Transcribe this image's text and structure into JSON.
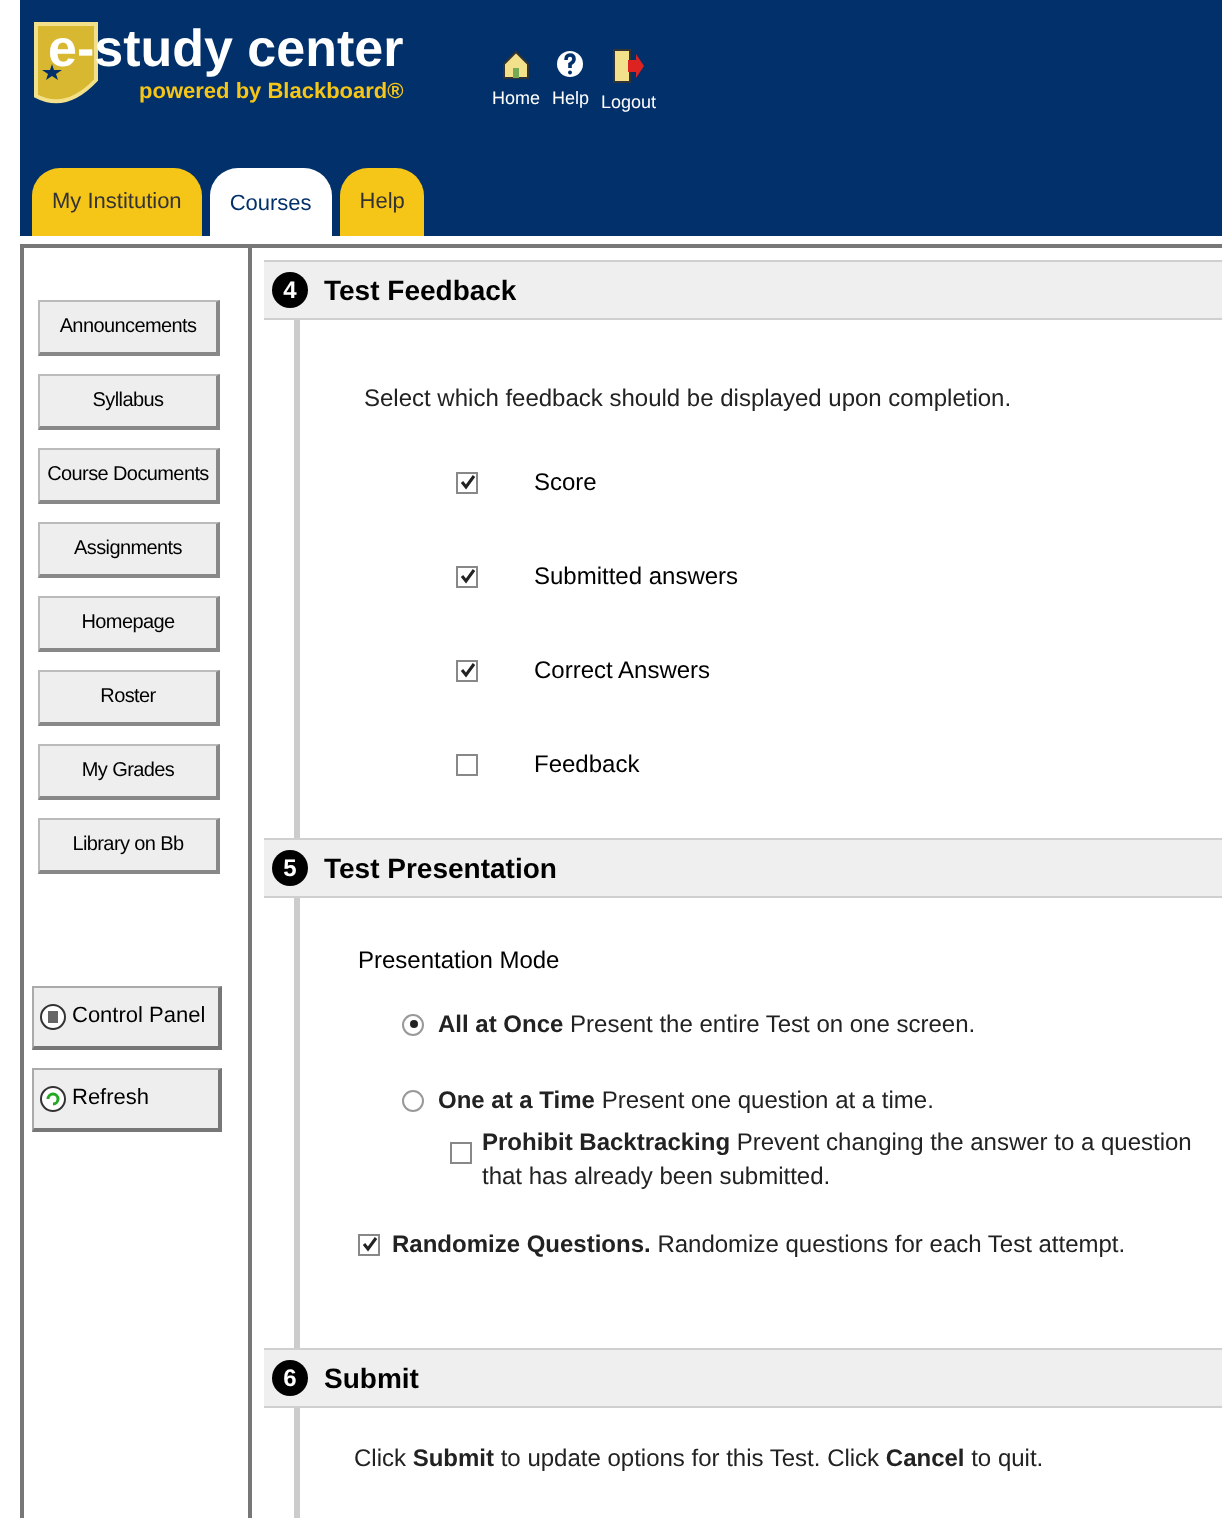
{
  "header": {
    "logo_title": "e-study center",
    "logo_subtitle": "powered by Blackboard®"
  },
  "top_links": [
    {
      "label": "Home",
      "kind": "home"
    },
    {
      "label": "Help",
      "kind": "help"
    },
    {
      "label": "Logout",
      "kind": "logout"
    }
  ],
  "tabs": [
    {
      "label": "My Institution",
      "selected": false
    },
    {
      "label": "Courses",
      "selected": true
    },
    {
      "label": "Help",
      "selected": false
    }
  ],
  "sidebar": {
    "items": [
      "Announcements",
      "Syllabus",
      "Course Documents",
      "Assignments",
      "Homepage",
      "Roster",
      "My Grades",
      "Library on Bb"
    ],
    "tools": [
      {
        "label": "Control Panel",
        "kind": "control"
      },
      {
        "label": "Refresh",
        "kind": "refresh"
      }
    ]
  },
  "feedback_section": {
    "number": "4",
    "title": "Test Feedback",
    "instruction": "Select which feedback should be displayed upon completion.",
    "options": [
      {
        "label": "Score",
        "checked": true
      },
      {
        "label": "Submitted answers",
        "checked": true
      },
      {
        "label": "Correct Answers",
        "checked": true
      },
      {
        "label": "Feedback",
        "checked": false
      }
    ]
  },
  "presentation_section": {
    "number": "5",
    "title": "Test Presentation",
    "mode_label": "Presentation Mode",
    "modes": [
      {
        "text": "**All at Once** Present the entire Test on one screen.",
        "selected": true
      },
      {
        "text": "**One at a Time** Present one question at a time.",
        "selected": false
      }
    ],
    "backtracking": {
      "text": "**Prohibit Backtracking** Prevent changing the answer to a question that has already been submitted.",
      "checked": false
    },
    "randomize": {
      "text": "**Randomize Questions.** Randomize questions for each Test attempt.",
      "checked": true
    }
  },
  "submit_section": {
    "number": "6",
    "title": "Submit",
    "text": "Click **Submit** to update options for this Test. Click **Cancel** to quit."
  }
}
